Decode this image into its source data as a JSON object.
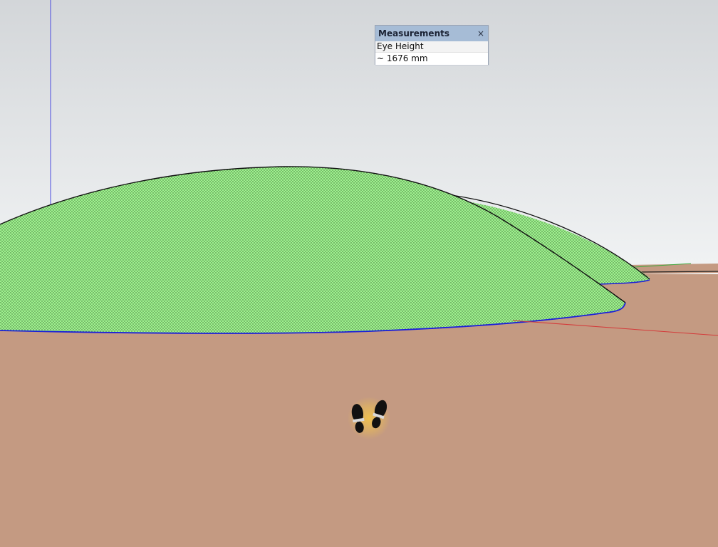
{
  "measurements": {
    "title": "Measurements",
    "close_glyph": "×",
    "label": "Eye Height",
    "value": "~ 1676 mm"
  },
  "scene": {
    "sky_top_color": "#d3d6d9",
    "sky_bottom_color": "#f1f3f4",
    "ground_color": "#c49a82",
    "terrain_fill": "#9ff28f",
    "terrain_edge": "#1a1fd9",
    "axis_blue": "#4a4ae0",
    "axis_red": "#d43a3a",
    "axis_green": "#3faa3f",
    "cursor_icon": "footprints-icon"
  }
}
